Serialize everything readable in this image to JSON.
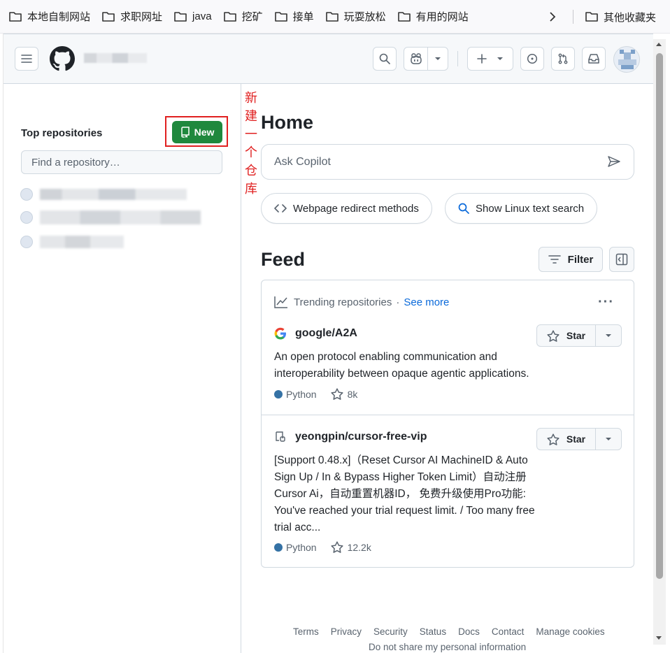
{
  "bookmarks": {
    "items": [
      {
        "label": "本地自制网站"
      },
      {
        "label": "求职网址"
      },
      {
        "label": "java"
      },
      {
        "label": "挖矿"
      },
      {
        "label": "接单"
      },
      {
        "label": "玩耍放松"
      },
      {
        "label": "有用的网站"
      }
    ],
    "other_label": "其他收藏夹"
  },
  "header": {
    "menu_icon": "hamburger-icon",
    "logo_icon": "github-octocat-icon"
  },
  "sidebar": {
    "annotation": "新建一个仓库",
    "top_repos_label": "Top repositories",
    "new_button_label": "New",
    "find_placeholder": "Find a repository…"
  },
  "main": {
    "home_title": "Home",
    "copilot_placeholder": "Ask Copilot",
    "chips": [
      {
        "label": "Webpage redirect methods",
        "icon": "code-icon"
      },
      {
        "label": "Show Linux text search",
        "icon": "search-icon"
      }
    ],
    "feed_title": "Feed",
    "filter_label": "Filter"
  },
  "feed": {
    "trending_label": "Trending repositories",
    "separator": "·",
    "see_more": "See more",
    "repos": [
      {
        "name": "google/A2A",
        "description": "An open protocol enabling communication and interoperability between opaque agentic applications.",
        "language": "Python",
        "language_color": "#3572a5",
        "stars": "8k",
        "star_label": "Star"
      },
      {
        "name": "yeongpin/cursor-free-vip",
        "description": "[Support 0.48.x]（Reset Cursor AI MachineID & Auto Sign Up / In & Bypass Higher Token Limit）自动注册 Cursor Ai，自动重置机器ID， 免费升级使用Pro功能: You've reached your trial request limit. / Too many free trial acc...",
        "language": "Python",
        "language_color": "#3572a5",
        "stars": "12.2k",
        "star_label": "Star"
      }
    ]
  },
  "footer": {
    "links": [
      "Terms",
      "Privacy",
      "Security",
      "Status",
      "Docs",
      "Contact",
      "Manage cookies"
    ],
    "line2": "Do not share my personal information"
  },
  "colors": {
    "accent_green": "#1f883d",
    "link_blue": "#0969da",
    "annotation_red": "#e02020"
  }
}
